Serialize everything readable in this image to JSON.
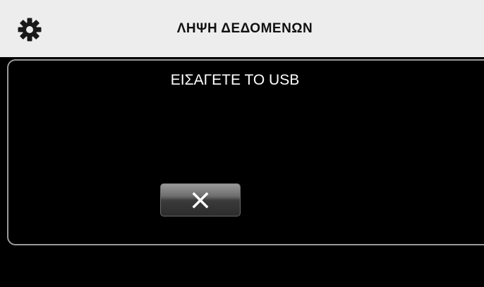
{
  "header": {
    "title": "ΛΗΨΗ ΔΕΔΟΜΕΝΩΝ",
    "settings_icon": "gear-icon"
  },
  "dialog": {
    "message": "ΕΙΣΑΓΕΤΕ ΤΟ USB",
    "close_icon": "close-icon"
  },
  "colors": {
    "header_background": "#ededed",
    "screen_background": "#000000",
    "dialog_border": "#9a9a9a",
    "text_primary": "#ffffff"
  }
}
